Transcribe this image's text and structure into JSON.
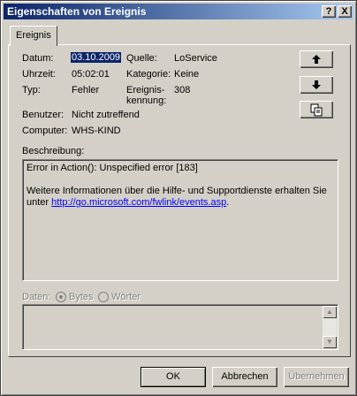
{
  "window": {
    "title": "Eigenschaften von Ereignis",
    "help_btn": "?",
    "close_btn": "X"
  },
  "tab": {
    "label": "Ereignis"
  },
  "fields": {
    "date_label": "Datum:",
    "date_value": "03.10.2009",
    "time_label": "Uhrzeit:",
    "time_value": "05:02:01",
    "type_label": "Typ:",
    "type_value": "Fehler",
    "user_label": "Benutzer:",
    "user_value": "Nicht zutreffend",
    "computer_label": "Computer:",
    "computer_value": "WHS-KIND",
    "source_label": "Quelle:",
    "source_value": "LoService",
    "category_label": "Kategorie:",
    "category_value": "Keine",
    "event_id_label_1": "Ereignis-",
    "event_id_label_2": "kennung:",
    "event_id_value": "308"
  },
  "nav_buttons": {
    "up_icon": "arrow-up",
    "down_icon": "arrow-down",
    "copy_icon": "copy"
  },
  "description": {
    "label": "Beschreibung:",
    "line1": "Error in Action(): Unspecified error [183]",
    "line2": "Weitere Informationen über die Hilfe- und Supportdienste erhalten Sie",
    "line3_prefix": "unter",
    "link": "http://go.microsoft.com/fwlink/events.asp",
    "line3_suffix": "."
  },
  "data": {
    "label": "Daten:",
    "option_bytes": "Bytes",
    "option_words": "Wörter"
  },
  "buttons": {
    "ok": "OK",
    "cancel": "Abbrechen",
    "apply": "Übernehmen"
  }
}
